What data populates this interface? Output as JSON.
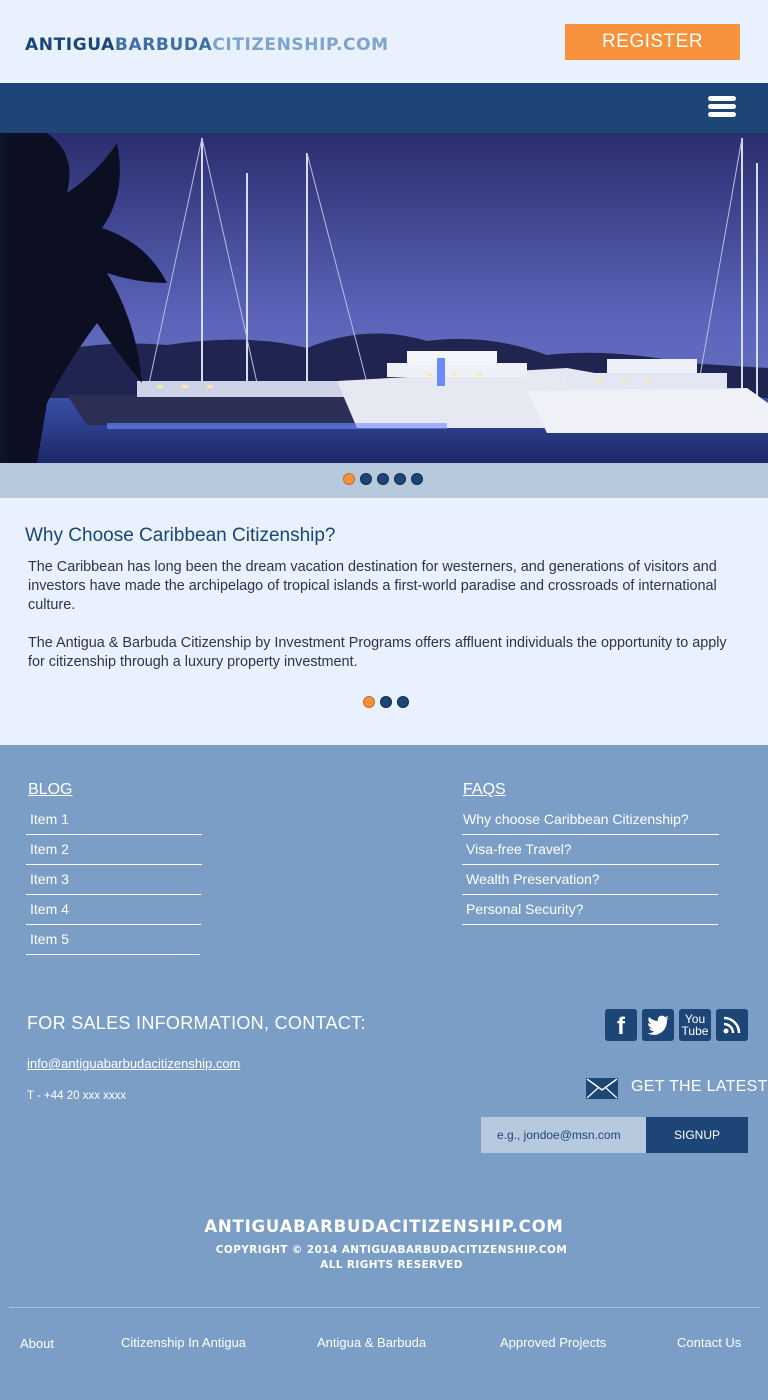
{
  "header": {
    "logo_part1": "ANTIGUA",
    "logo_part2": "BARBUDA",
    "logo_part3": "CITIZENSHIP.COM",
    "register_label": "REGISTER"
  },
  "hero": {
    "slide_count": 5,
    "active_slide": 1
  },
  "article": {
    "title": "Why Choose Caribbean Citizenship?",
    "paragraph1": "The Caribbean has long been the dream vacation destination for westerners, and generations of visitors and investors have made the archipelago of tropical islands a first-world paradise and crossroads of international culture.",
    "paragraph2": "The Antigua & Barbuda Citizenship by Investment Programs offers affluent individuals the opportunity to apply for citizenship through a luxury property investment.",
    "page_count": 3,
    "active_page": 1
  },
  "blog": {
    "title": "BLOG",
    "items": [
      "Item 1",
      "Item 2",
      "Item 3",
      "Item 4",
      "Item 5"
    ]
  },
  "faqs": {
    "title": "FAQS",
    "items": [
      "Why choose Caribbean Citizenship?",
      "Visa-free Travel?",
      "Wealth Preservation?",
      "Personal Security?"
    ]
  },
  "contact": {
    "title": "FOR SALES INFORMATION, CONTACT:",
    "email": "info@antiguabarbudacitizenship.com",
    "phone": "T - +44 20 xxx xxxx"
  },
  "social": {
    "icons": [
      "facebook-icon",
      "twitter-icon",
      "youtube-icon",
      "rss-icon"
    ],
    "youtube_line1": "You",
    "youtube_line2": "Tube"
  },
  "newsletter": {
    "label": "GET THE LATEST",
    "placeholder": "e.g., jondoe@msn.com",
    "button": "SIGNUP"
  },
  "footer": {
    "logo": "ANTIGUABARBUDACITIZENSHIP.COM",
    "copyright1": "COPYRIGHT © 2014 ANTIGUABARBUDACITIZENSHIP.COM",
    "copyright2": "ALL RIGHTS RESERVED",
    "links": [
      "About",
      "Citizenship In Antigua",
      "Antigua & Barbuda",
      "Approved Projects",
      "Contact Us"
    ]
  },
  "colors": {
    "accent": "#f7913c",
    "navy": "#1d4576",
    "footer_bg": "#7b9ec7",
    "light_bg": "#e8f1fd"
  }
}
